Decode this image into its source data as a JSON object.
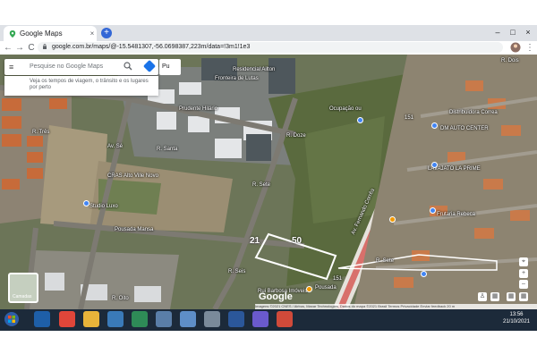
{
  "browser": {
    "tab_title": "Google Maps",
    "tab_close": "×",
    "new_tab": "+",
    "url": "google.com.br/maps/@-15.5481307,-56.0698387,223m/data=!3m1!1e3",
    "back": "←",
    "forward": "→",
    "reload": "C",
    "win_min": "–",
    "win_max": "□",
    "win_close": "×"
  },
  "maps": {
    "menu": "≡",
    "search_placeholder": "Pesquise no Google Maps",
    "suggestion": "Veja os tempos de viagem, o trânsito e os lugares por perto",
    "pu_label": "Pu",
    "layers_label": "Camadas",
    "google": "Google",
    "footer": "Imagens ©2021 CNES / Airbus, Maxar Technologies, Dados do mapa ©2021   Brasil   Termos   Privacidade   Enviar feedback   20 m"
  },
  "map_labels": [
    {
      "id": "resid-1",
      "text": "Residencial Ailton"
    },
    {
      "id": "fronteira",
      "text": "Fronteira de Lutas"
    },
    {
      "id": "prudente",
      "text": "Prudente Hilário"
    },
    {
      "id": "ocupacao",
      "text": "Ocupação ou"
    },
    {
      "id": "distribuidora",
      "text": "Distribuidora Correa"
    },
    {
      "id": "dm-auto",
      "text": "DM AUTO CENTER"
    },
    {
      "id": "lavaprime",
      "text": "LAVAJATO LA PRIME"
    },
    {
      "id": "frutaria",
      "text": "Frutaria Rebeca"
    },
    {
      "id": "cras",
      "text": "CRAS Alto Ville Novo"
    },
    {
      "id": "studio",
      "text": "Studio Luxo"
    },
    {
      "id": "mansa",
      "text": "Pousada Mansa"
    },
    {
      "id": "rui",
      "text": "Rui Barbosa Imóveis"
    },
    {
      "id": "rua-d",
      "text": "Av. Fernando Corrêa"
    },
    {
      "id": "r3",
      "text": "R. Três"
    },
    {
      "id": "r4",
      "text": "R. Santa"
    },
    {
      "id": "r5",
      "text": "R. Doze"
    },
    {
      "id": "r6",
      "text": "R. Sete"
    },
    {
      "id": "r7",
      "text": "R. Oito"
    },
    {
      "id": "r8",
      "text": "R. Seis"
    },
    {
      "id": "r9",
      "text": "R. Dois"
    },
    {
      "id": "r10",
      "text": "Av. Sé"
    },
    {
      "id": "r11",
      "text": "R. Sete"
    },
    {
      "id": "bus",
      "text": "Pousada"
    },
    {
      "id": "hw1",
      "text": "151"
    },
    {
      "id": "hw2",
      "text": "151"
    }
  ],
  "annotations": {
    "lot_left": "21",
    "lot_right": "50"
  },
  "taskbar": {
    "time": "13:56",
    "date": "21/10/2021"
  },
  "colors": {
    "chrome_bg": "#dee1e6",
    "taskbar_bg": "#1c2a3a",
    "avenue": "#d8706b",
    "accent": "#1a73e8"
  }
}
